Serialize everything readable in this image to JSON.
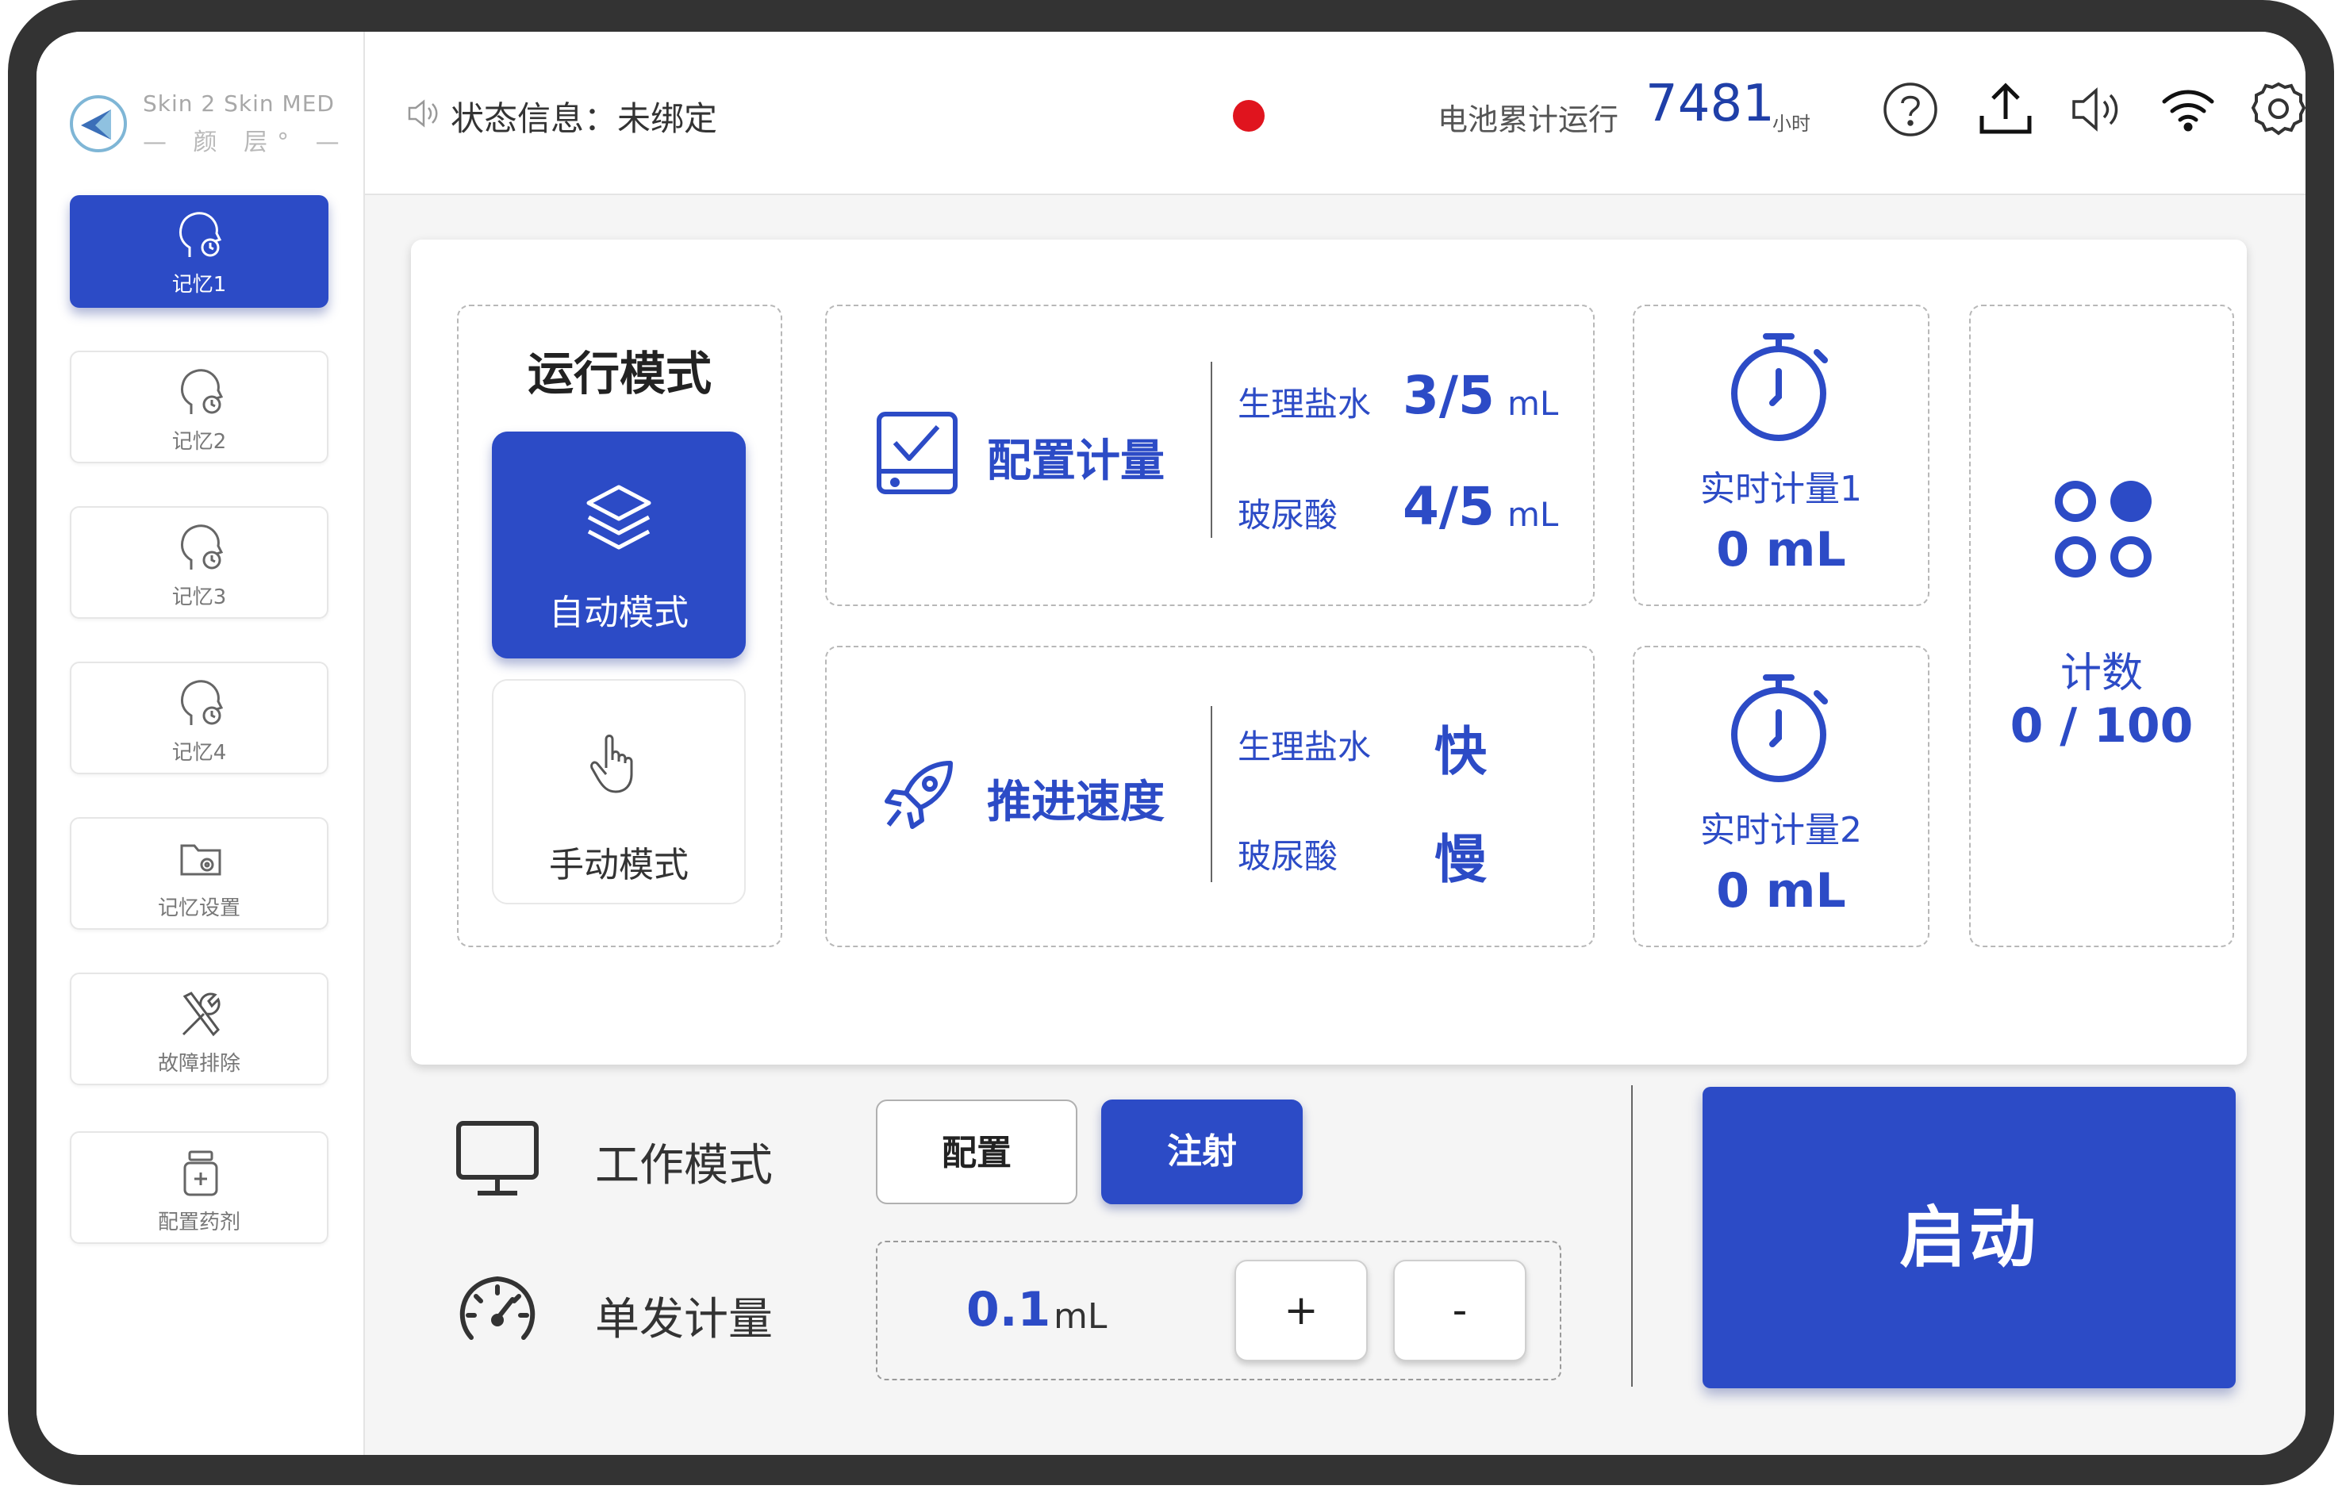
{
  "brand": {
    "name_line1": "Skin 2 Skin MED",
    "name_line2": "— 颜 层° —"
  },
  "sidebar": {
    "items": [
      {
        "label": "记忆1",
        "icon": "head-clock-icon",
        "active": true
      },
      {
        "label": "记忆2",
        "icon": "head-clock-icon",
        "active": false
      },
      {
        "label": "记忆3",
        "icon": "head-clock-icon",
        "active": false
      },
      {
        "label": "记忆4",
        "icon": "head-clock-icon",
        "active": false
      },
      {
        "label": "记忆设置",
        "icon": "folder-gear-icon",
        "active": false
      },
      {
        "label": "故障排除",
        "icon": "tools-icon",
        "active": false
      },
      {
        "label": "配置药剂",
        "icon": "medicine-bottle-icon",
        "active": false
      }
    ]
  },
  "header": {
    "status_text": "状态信息：未绑定",
    "battery_label": "电池累计运行",
    "battery_value": "7481",
    "battery_unit": "小时",
    "icons": [
      "help-icon",
      "upload-icon",
      "volume-icon",
      "wifi-icon",
      "settings-icon"
    ]
  },
  "run_mode": {
    "title": "运行模式",
    "auto_label": "自动模式",
    "manual_label": "手动模式",
    "selected": "auto"
  },
  "config_dose": {
    "title": "配置计量",
    "rows": [
      {
        "label": "生理盐水",
        "value": "3/5",
        "unit": "mL"
      },
      {
        "label": "玻尿酸",
        "value": "4/5",
        "unit": "mL"
      }
    ]
  },
  "push_speed": {
    "title": "推进速度",
    "rows": [
      {
        "label": "生理盐水",
        "value": "快"
      },
      {
        "label": "玻尿酸",
        "value": "慢"
      }
    ]
  },
  "realtime": [
    {
      "label": "实时计量1",
      "value": "0 mL"
    },
    {
      "label": "实时计量2",
      "value": "0 mL"
    }
  ],
  "counter": {
    "label": "计数",
    "value": "0 / 100"
  },
  "work_mode": {
    "label": "工作模式",
    "options": [
      "配置",
      "注射"
    ],
    "selected": "注射"
  },
  "single_dose": {
    "label": "单发计量",
    "value": "0.1",
    "unit": "mL",
    "plus": "+",
    "minus": "-"
  },
  "start_label": "启动",
  "colors": {
    "accent": "#2c4bc6",
    "record": "#e0141e",
    "frame": "#333333"
  }
}
